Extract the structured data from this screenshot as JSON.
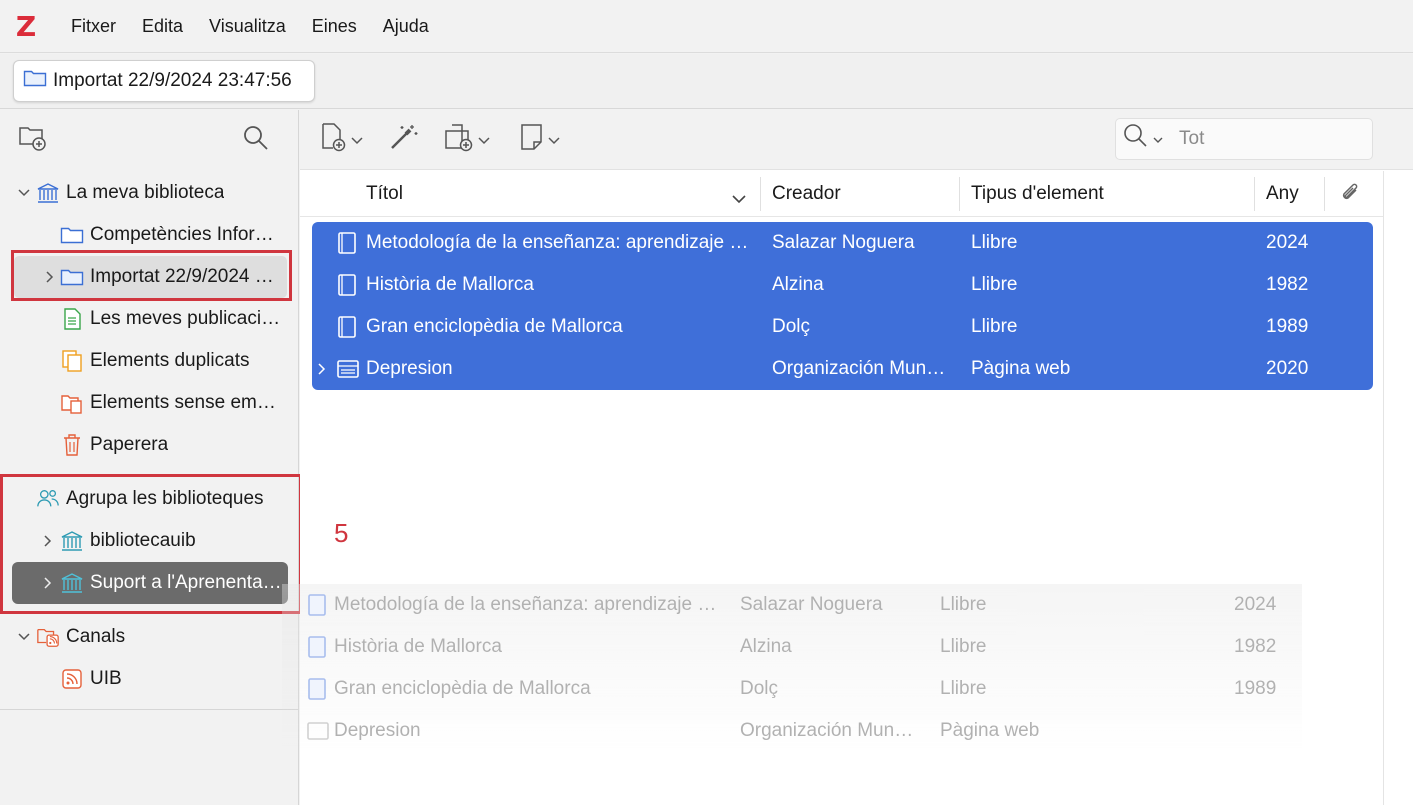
{
  "app": {
    "logo": "Z"
  },
  "menu": [
    "Fitxer",
    "Edita",
    "Visualitza",
    "Eines",
    "Ajuda"
  ],
  "tab": {
    "label": "Importat 22/9/2024 23:47:56"
  },
  "colors": {
    "selection": "#3f6fd9",
    "highlight_box": "#d0363f",
    "library": "#3b6fd4",
    "group": "#2e9bb3",
    "feed": "#e5603a",
    "duplicates": "#f0a020"
  },
  "tree": {
    "my_library": "La meva biblioteca",
    "collection_1": "Competències Infor…",
    "collection_2": "Importat 22/9/2024 …",
    "my_publications": "Les meves publicaci…",
    "duplicates": "Elements duplicats",
    "unfiled": "Elements sense emp…",
    "trash": "Paperera",
    "group_libraries": "Agrupa les biblioteques",
    "group_1": "bibliotecauib",
    "group_2": "Suport a l'Aprenenta…",
    "feeds": "Canals",
    "feed_1": "UIB"
  },
  "search": {
    "placeholder": "Tot"
  },
  "columns": {
    "title": "Títol",
    "creator": "Creador",
    "item_type": "Tipus d'element",
    "year": "Any"
  },
  "items": [
    {
      "title": "Metodología de la enseñanza: aprendizaje …",
      "creator": "Salazar Noguera",
      "type": "Llibre",
      "year": "2024",
      "icon": "book-icon"
    },
    {
      "title": "Història de Mallorca",
      "creator": "Alzina",
      "type": "Llibre",
      "year": "1982",
      "icon": "book-icon"
    },
    {
      "title": "Gran enciclopèdia de Mallorca",
      "creator": "Dolç",
      "type": "Llibre",
      "year": "1989",
      "icon": "book-icon"
    },
    {
      "title": "Depresion",
      "creator": "Organización Mun…",
      "type": "Pàgina web",
      "year": "2020",
      "icon": "webpage-icon"
    }
  ],
  "annotation": "5"
}
